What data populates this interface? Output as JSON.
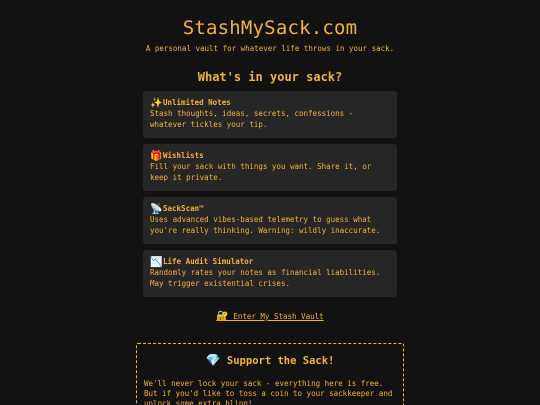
{
  "header": {
    "title": "StashMySack.com",
    "tagline": "A personal vault for whatever life throws in your sack."
  },
  "features": {
    "heading": "What's in your sack?",
    "cards": [
      {
        "icon": "sparkles-icon",
        "icon_glyph": "✨",
        "title": "Unlimited Notes",
        "description": "Stash thoughts, ideas, secrets, confessions - whatever tickles your tip."
      },
      {
        "icon": "gift-icon",
        "icon_glyph": "🎁",
        "title": "Wishlists",
        "description": "Fill your sack with things you want. Share it, or keep it private."
      },
      {
        "icon": "satellite-antenna-icon",
        "icon_glyph": "📡",
        "title": "SackScan™",
        "description": "Uses advanced vibes-based telemetry to guess what you're really thinking. Warning: wildly inaccurate."
      },
      {
        "icon": "chart-decreasing-icon",
        "icon_glyph": "📉",
        "title": "Life Audit Simulator",
        "description": "Randomly rates your notes as financial liabilities. May trigger existential crises."
      }
    ]
  },
  "cta": {
    "icon": "lock-with-key-icon",
    "icon_glyph": "🔐",
    "label": "Enter My Stash Vault"
  },
  "support": {
    "icon": "gem-icon",
    "icon_glyph": "💎",
    "title": "Support the Sack!",
    "line1": "We'll never lock your sack - everything here is free.",
    "line2": "But if you'd like to toss a coin to your sackkeeper and unlock some extra bling!"
  },
  "colors": {
    "background": "#121212",
    "accent": "#f2b33d",
    "card": "#262626"
  }
}
